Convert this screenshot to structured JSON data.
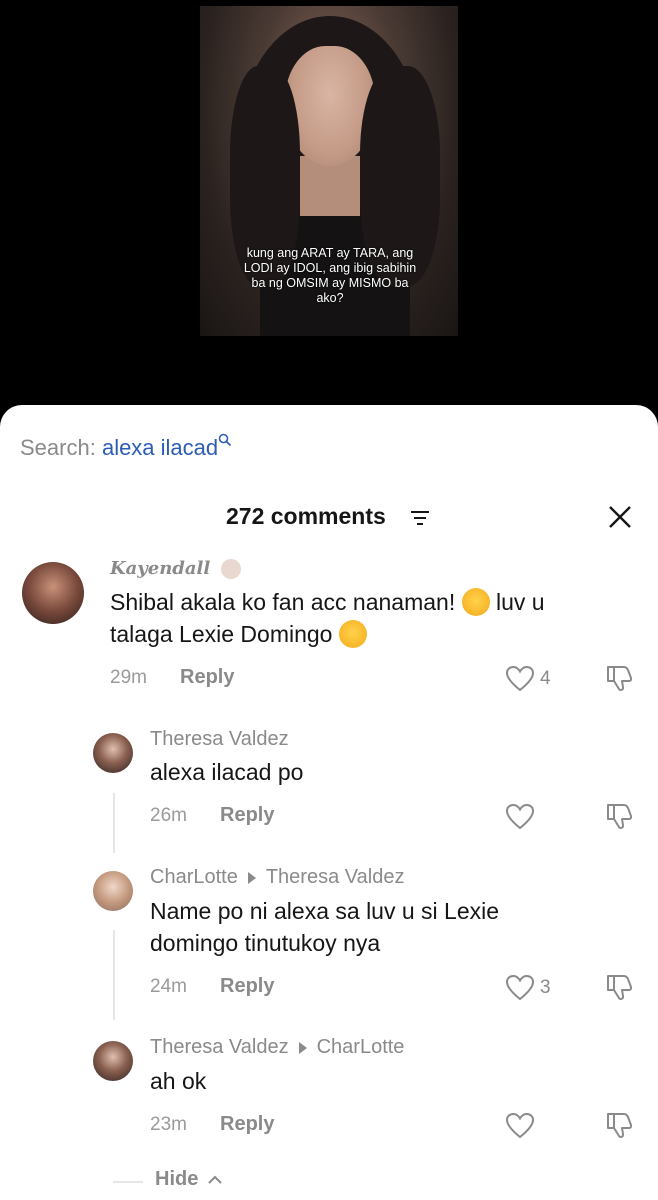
{
  "video": {
    "caption": "kung ang ARAT ay TARA, ang LODI ay IDOL, ang ibig sabihin ba ng OMSIM ay MISMO ba ako?"
  },
  "search": {
    "label": "Search:",
    "query": "alexa ilacad"
  },
  "header": {
    "title": "272 comments"
  },
  "comments": [
    {
      "username": "Kayendall",
      "text_part1": "Shibal akala ko fan acc nanaman!",
      "text_part2": "luv u",
      "text_line2": "talaga Lexie Domingo",
      "time": "29m",
      "reply_label": "Reply",
      "likes": "4"
    }
  ],
  "replies": [
    {
      "username": "Theresa Valdez",
      "text": "alexa ilacad po",
      "time": "26m",
      "reply_label": "Reply",
      "likes": ""
    },
    {
      "username": "CharLotte",
      "reply_to": "Theresa Valdez",
      "text_line1": "Name po ni alexa sa luv u si Lexie",
      "text_line2": "domingo tinutukoy nya",
      "time": "24m",
      "reply_label": "Reply",
      "likes": "3"
    },
    {
      "username": "Theresa Valdez",
      "reply_to": "CharLotte",
      "text": "ah ok",
      "time": "23m",
      "reply_label": "Reply",
      "likes": ""
    }
  ],
  "hide_label": "Hide",
  "colors": {
    "accent_link": "#2c5db5",
    "muted": "#8a8a8a"
  },
  "icons": [
    "search-icon",
    "filter-icon",
    "close-icon",
    "heart-icon",
    "dislike-icon",
    "chevron-up-icon",
    "crying-emoji-icon",
    "kiss-emoji-icon"
  ]
}
